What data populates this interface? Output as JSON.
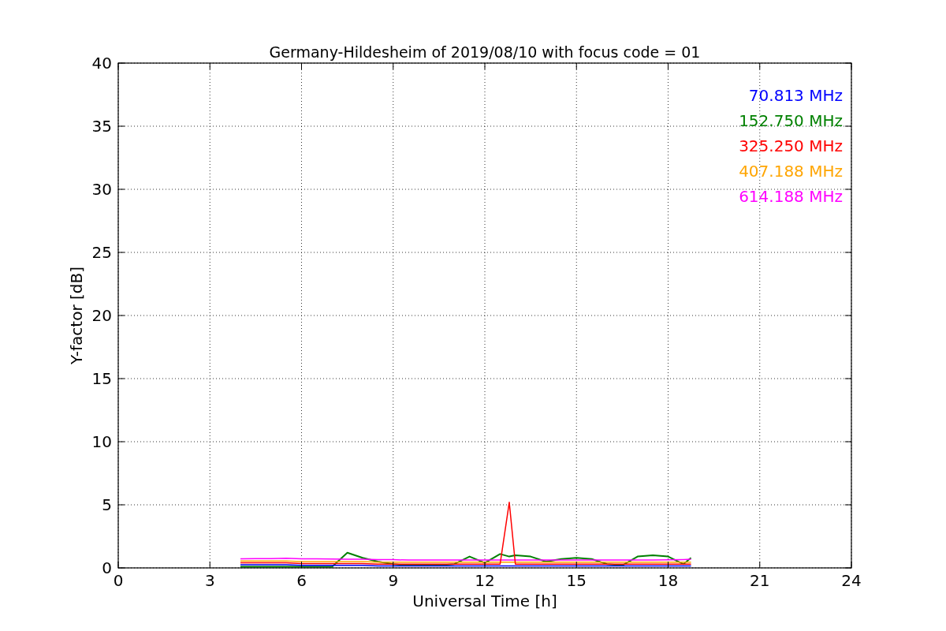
{
  "chart_data": {
    "type": "line",
    "title": "Germany-Hildesheim of 2019/08/10 with focus code = 01",
    "xlabel": "Universal Time [h]",
    "ylabel": "Y-factor [dB]",
    "x": [
      4,
      4.5,
      5,
      5.5,
      6,
      6.5,
      7,
      7.5,
      8,
      8.5,
      9,
      9.5,
      10,
      10.5,
      11,
      11.5,
      12,
      12.5,
      12.8,
      13,
      13.5,
      14,
      14.5,
      15,
      15.5,
      16,
      16.5,
      17,
      17.5,
      18,
      18.5,
      18.75
    ],
    "series": [
      {
        "name": "70.813 MHz",
        "color": "#0000ff",
        "values": [
          0.25,
          0.25,
          0.25,
          0.25,
          0.2,
          0.2,
          0.2,
          0.2,
          0.2,
          0.15,
          0.15,
          0.15,
          0.15,
          0.15,
          0.15,
          0.15,
          0.15,
          0.15,
          0.15,
          0.15,
          0.15,
          0.15,
          0.15,
          0.15,
          0.15,
          0.15,
          0.15,
          0.15,
          0.15,
          0.15,
          0.15,
          0.15
        ]
      },
      {
        "name": "152.750 MHz",
        "color": "#008000",
        "values": [
          0.1,
          0.1,
          0.1,
          0.1,
          0.1,
          0.1,
          0.1,
          1.2,
          0.8,
          0.5,
          0.3,
          0.2,
          0.2,
          0.2,
          0.3,
          0.9,
          0.4,
          1.1,
          0.9,
          1.0,
          0.9,
          0.5,
          0.7,
          0.8,
          0.7,
          0.3,
          0.2,
          0.9,
          1.0,
          0.9,
          0.3,
          0.8
        ]
      },
      {
        "name": "325.250 MHz",
        "color": "#ff0000",
        "values": [
          0.4,
          0.4,
          0.4,
          0.4,
          0.35,
          0.35,
          0.35,
          0.35,
          0.35,
          0.3,
          0.3,
          0.3,
          0.3,
          0.3,
          0.3,
          0.3,
          0.3,
          0.3,
          5.2,
          0.3,
          0.3,
          0.3,
          0.3,
          0.3,
          0.3,
          0.3,
          0.3,
          0.3,
          0.3,
          0.3,
          0.3,
          0.3
        ]
      },
      {
        "name": "407.188 MHz",
        "color": "#ffa500",
        "values": [
          0.55,
          0.55,
          0.55,
          0.55,
          0.5,
          0.5,
          0.5,
          0.5,
          0.5,
          0.45,
          0.45,
          0.45,
          0.45,
          0.45,
          0.45,
          0.45,
          0.45,
          0.45,
          0.45,
          0.45,
          0.45,
          0.45,
          0.45,
          0.45,
          0.45,
          0.45,
          0.45,
          0.45,
          0.45,
          0.45,
          0.45,
          0.45
        ]
      },
      {
        "name": "614.188 MHz",
        "color": "#ff00ff",
        "values": [
          0.72,
          0.74,
          0.74,
          0.76,
          0.72,
          0.72,
          0.7,
          0.68,
          0.68,
          0.65,
          0.65,
          0.62,
          0.62,
          0.62,
          0.62,
          0.62,
          0.62,
          0.62,
          0.62,
          0.62,
          0.62,
          0.62,
          0.62,
          0.62,
          0.62,
          0.62,
          0.62,
          0.62,
          0.62,
          0.64,
          0.66,
          0.68
        ]
      }
    ],
    "grid": true,
    "xlim": [
      0,
      24
    ],
    "ylim": [
      0,
      40
    ],
    "xticks": [
      0,
      3,
      6,
      9,
      12,
      15,
      18,
      21,
      24
    ],
    "yticks": [
      0,
      5,
      10,
      15,
      20,
      25,
      30,
      35,
      40
    ]
  }
}
